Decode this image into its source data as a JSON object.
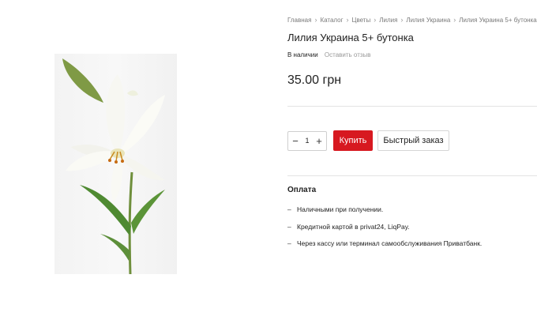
{
  "breadcrumb": [
    {
      "label": "Главная"
    },
    {
      "label": "Каталог"
    },
    {
      "label": "Цветы"
    },
    {
      "label": "Лилия"
    },
    {
      "label": "Лилия Украина"
    },
    {
      "label": "Лилия Украина 5+ бутонка"
    }
  ],
  "product": {
    "title": "Лилия Украина 5+ бутонка",
    "stock_status": "В наличии",
    "review_link": "Оставить отзыв",
    "price": "35.00 грн",
    "image_icon": "lily-flower-image"
  },
  "purchase": {
    "quantity": "1",
    "minus_glyph": "−",
    "plus_glyph": "+",
    "buy_label": "Купить",
    "quick_order_label": "Быстрый заказ",
    "buy_color": "#d71920"
  },
  "payment": {
    "title": "Оплата",
    "bullet": "–",
    "methods": [
      "Наличными при получении.",
      "Кредитной картой в privat24, LiqPay.",
      "Через кассу или терминал самообслуживания Приватбанк."
    ]
  }
}
